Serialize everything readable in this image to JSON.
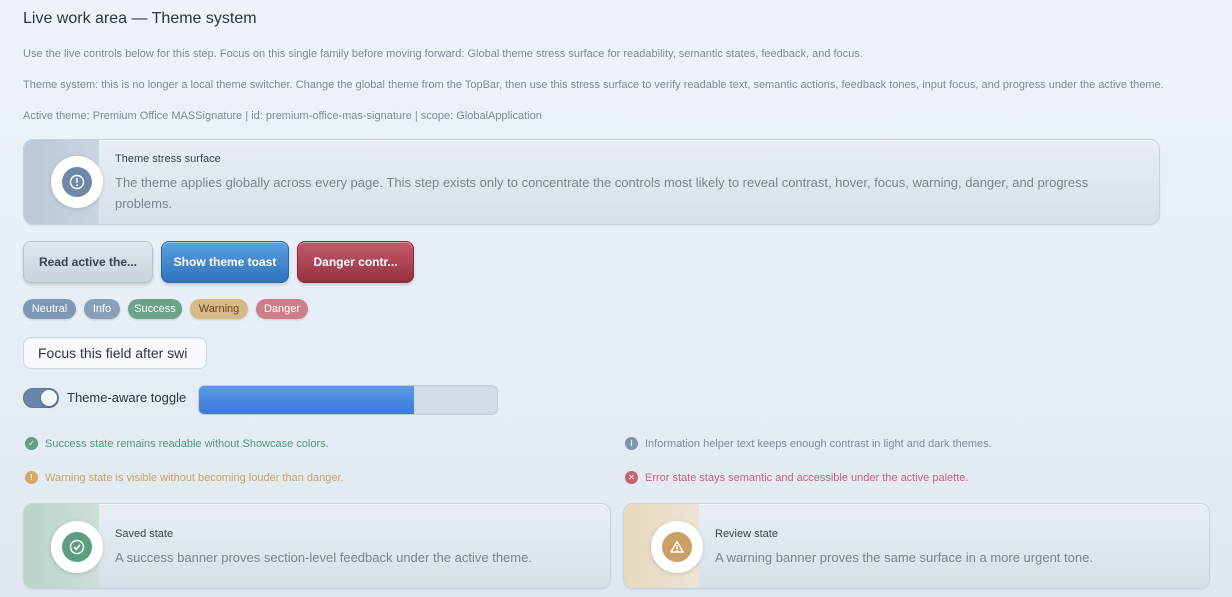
{
  "header": {
    "title": "Live work area — Theme system",
    "instructions": "Use the live controls below for this step. Focus on this single family before moving forward: Global theme stress surface for readability, semantic states, feedback, and focus.",
    "theme_note": "Theme system: this is no longer a local theme switcher. Change the global theme from the TopBar, then use this stress surface to verify readable text, semantic actions, feedback tones, input focus, and progress under the active theme.",
    "active_theme": "Active theme: Premium Office MASSignature | id: premium-office-mas-signature | scope: GlobalApplication"
  },
  "stress_banner": {
    "title": "Theme stress surface",
    "text": "The theme applies globally across every page. This step exists only to concentrate the controls most likely to reveal contrast, hover, focus, warning, danger, and progress problems.",
    "icon": "info-icon"
  },
  "buttons": {
    "read_label": "Read active the...",
    "toast_label": "Show theme toast",
    "danger_label": "Danger contr..."
  },
  "badges": {
    "neutral": "Neutral",
    "info": "Info",
    "success": "Success",
    "warning": "Warning",
    "danger": "Danger"
  },
  "input": {
    "value": "Focus this field after swi"
  },
  "toggle": {
    "label": "Theme-aware toggle",
    "on": true
  },
  "progress": {
    "value": 0.72
  },
  "helpers": {
    "success": "Success state remains readable without Showcase colors.",
    "info": "Information helper text keeps enough contrast in light and dark themes.",
    "warning": "Warning state is visible without becoming louder than danger.",
    "error": "Error state stays semantic and accessible under the active palette."
  },
  "saved_banner": {
    "title": "Saved state",
    "text": "A success banner proves section-level feedback under the active theme.",
    "icon": "check-circle-icon"
  },
  "review_banner": {
    "title": "Review state",
    "text": "A warning banner proves the same surface in a more urgent tone.",
    "icon": "warning-triangle-icon"
  },
  "colors": {
    "primary": "#3a7ad6",
    "danger": "#96313f",
    "success": "#5fa182",
    "warning": "#d4a966",
    "info": "#7f95ad"
  }
}
